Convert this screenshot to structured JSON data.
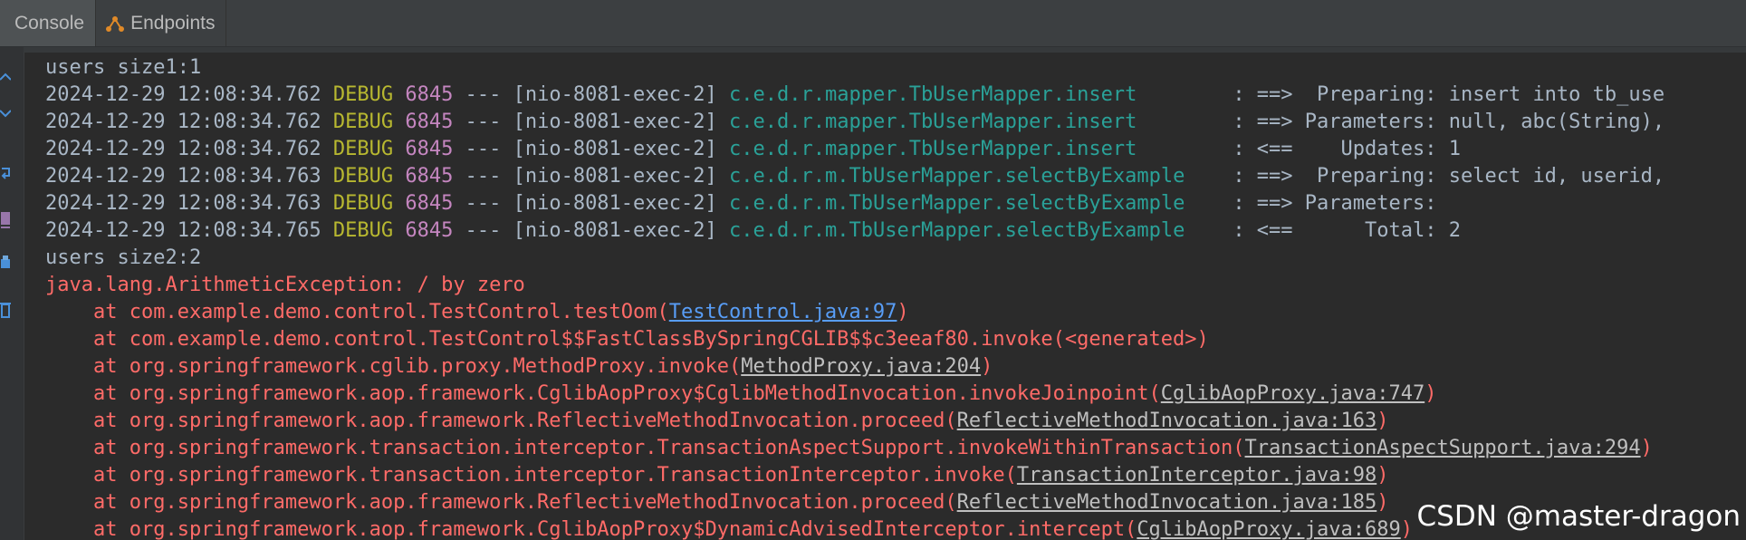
{
  "tabs": [
    {
      "label": "Console",
      "icon": "console-icon",
      "active": true
    },
    {
      "label": "Endpoints",
      "icon": "endpoints-icon",
      "active": false
    }
  ],
  "colors": {
    "debug": "#b8b830",
    "pid": "#c586c0",
    "logger": "#2aa198",
    "error": "#ff6b68",
    "link": "#589df6"
  },
  "console": {
    "pre_line": "users size1:1",
    "debug_lines": [
      {
        "timestamp": "2024-12-29 12:08:34.762",
        "level": "DEBUG",
        "pid": "6845",
        "sep": "---",
        "thread": "[nio-8081-exec-2]",
        "logger": "c.e.d.r.mapper.TbUserMapper.insert       ",
        "message": ": ==>  Preparing: insert into tb_use"
      },
      {
        "timestamp": "2024-12-29 12:08:34.762",
        "level": "DEBUG",
        "pid": "6845",
        "sep": "---",
        "thread": "[nio-8081-exec-2]",
        "logger": "c.e.d.r.mapper.TbUserMapper.insert       ",
        "message": ": ==> Parameters: null, abc(String),"
      },
      {
        "timestamp": "2024-12-29 12:08:34.762",
        "level": "DEBUG",
        "pid": "6845",
        "sep": "---",
        "thread": "[nio-8081-exec-2]",
        "logger": "c.e.d.r.mapper.TbUserMapper.insert       ",
        "message": ": <==    Updates: 1"
      },
      {
        "timestamp": "2024-12-29 12:08:34.763",
        "level": "DEBUG",
        "pid": "6845",
        "sep": "---",
        "thread": "[nio-8081-exec-2]",
        "logger": "c.e.d.r.m.TbUserMapper.selectByExample   ",
        "message": ": ==>  Preparing: select id, userid,"
      },
      {
        "timestamp": "2024-12-29 12:08:34.763",
        "level": "DEBUG",
        "pid": "6845",
        "sep": "---",
        "thread": "[nio-8081-exec-2]",
        "logger": "c.e.d.r.m.TbUserMapper.selectByExample   ",
        "message": ": ==> Parameters: "
      },
      {
        "timestamp": "2024-12-29 12:08:34.765",
        "level": "DEBUG",
        "pid": "6845",
        "sep": "---",
        "thread": "[nio-8081-exec-2]",
        "logger": "c.e.d.r.m.TbUserMapper.selectByExample   ",
        "message": ": <==      Total: 2"
      }
    ],
    "post_line": "users size2:2",
    "exception": "java.lang.ArithmeticException: / by zero",
    "stack": [
      {
        "prefix": "    at com.example.demo.control.TestControl.testOom(",
        "link": "TestControl.java:97",
        "suffix": ")",
        "link_style": "blue"
      },
      {
        "prefix": "    at com.example.demo.control.TestControl$$FastClassBySpringCGLIB$$c3eeaf80.invoke(<generated>)",
        "link": "",
        "suffix": "",
        "link_style": "none"
      },
      {
        "prefix": "    at org.springframework.cglib.proxy.MethodProxy.invoke(",
        "link": "MethodProxy.java:204",
        "suffix": ")",
        "link_style": "grey"
      },
      {
        "prefix": "    at org.springframework.aop.framework.CglibAopProxy$CglibMethodInvocation.invokeJoinpoint(",
        "link": "CglibAopProxy.java:747",
        "suffix": ")",
        "link_style": "grey"
      },
      {
        "prefix": "    at org.springframework.aop.framework.ReflectiveMethodInvocation.proceed(",
        "link": "ReflectiveMethodInvocation.java:163",
        "suffix": ")",
        "link_style": "grey"
      },
      {
        "prefix": "    at org.springframework.transaction.interceptor.TransactionAspectSupport.invokeWithinTransaction(",
        "link": "TransactionAspectSupport.java:294",
        "suffix": ")",
        "link_style": "grey"
      },
      {
        "prefix": "    at org.springframework.transaction.interceptor.TransactionInterceptor.invoke(",
        "link": "TransactionInterceptor.java:98",
        "suffix": ")",
        "link_style": "grey"
      },
      {
        "prefix": "    at org.springframework.aop.framework.ReflectiveMethodInvocation.proceed(",
        "link": "ReflectiveMethodInvocation.java:185",
        "suffix": ")",
        "link_style": "grey"
      },
      {
        "prefix": "    at org.springframework.aop.framework.CglibAopProxy$DynamicAdvisedInterceptor.intercept(",
        "link": "CglibAopProxy.java:689",
        "suffix": ")",
        "link_style": "grey"
      }
    ]
  },
  "watermark": "CSDN @master-dragon"
}
